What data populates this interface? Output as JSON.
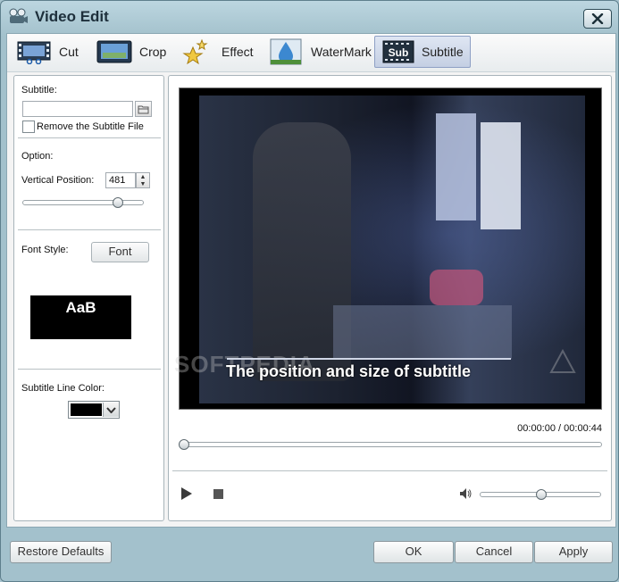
{
  "window": {
    "title": "Video Edit",
    "close_icon": "close-icon"
  },
  "tabs": [
    {
      "label": "Cut",
      "icon": "film-cut-icon",
      "active": false
    },
    {
      "label": "Crop",
      "icon": "crop-icon",
      "active": false
    },
    {
      "label": "Effect",
      "icon": "effect-stars-icon",
      "active": false
    },
    {
      "label": "WaterMark",
      "icon": "watermark-drop-icon",
      "active": false
    },
    {
      "label": "Subtitle",
      "icon": "subtitle-icon",
      "icon_text": "Sub",
      "active": true
    }
  ],
  "left_panel": {
    "subtitle_label": "Subtitle:",
    "subtitle_file_value": "",
    "remove_subtitle_label": "Remove the Subtitle File",
    "remove_subtitle_checked": false,
    "option_label": "Option:",
    "vertical_position_label": "Vertical Position:",
    "vertical_position_value": "481",
    "vertical_position_slider_fraction": 0.8,
    "font_style_label": "Font Style:",
    "font_button_label": "Font",
    "font_preview_text": "AaB",
    "line_color_label": "Subtitle Line Color:",
    "line_color": "#000000"
  },
  "preview": {
    "subtitle_text": "The position and size of subtitle",
    "watermark_text": "SOFTPEDIA",
    "current_time": "00:00:00",
    "time_separator": "/",
    "total_time": "00:00:44",
    "seek_fraction": 0.0,
    "volume_fraction": 0.5
  },
  "controls": {
    "play_icon": "play-icon",
    "stop_icon": "stop-icon",
    "volume_icon": "speaker-icon"
  },
  "footer": {
    "restore_label": "Restore Defaults",
    "ok_label": "OK",
    "cancel_label": "Cancel",
    "apply_label": "Apply"
  },
  "colors": {
    "frame_bg": "#a3c1cc",
    "active_tab": "#c4cfe3",
    "subtitle_line": "#000000"
  }
}
